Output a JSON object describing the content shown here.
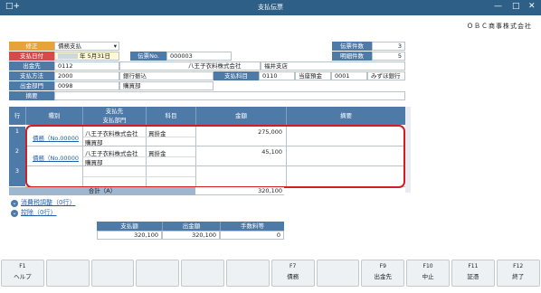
{
  "window": {
    "title": "支払伝票",
    "app_icon": "plus-icon"
  },
  "company": "ＯＢＣ商事株式会社",
  "header": {
    "correction_label": "修正",
    "correction_value": "債務支払",
    "date_label": "支払日付",
    "date_value": "年 5月31日",
    "voucher_label": "伝票No.",
    "voucher_value": "000003",
    "payee_label": "出金先",
    "payee_code": "0112",
    "payee_name": "八王子衣料株式会社",
    "payee_branch": "福井支店",
    "method_label": "支払方法",
    "method_code": "2000",
    "method_name": "銀行振込",
    "account_label": "支払科目",
    "account_code": "0110",
    "account_name": "当座預金",
    "bank_code": "0001",
    "bank_name": "みずほ銀行",
    "dept_label": "出金部門",
    "dept_code": "0098",
    "dept_name": "購買部",
    "memo_label": "摘要",
    "count_label": "伝票件数",
    "count_value": "3",
    "detail_label": "明細件数",
    "detail_value": "5"
  },
  "grid": {
    "columns": {
      "row": "行",
      "kind": "種別",
      "payee": "支払先",
      "payee_dept": "支払部門",
      "subject": "科目",
      "amount": "金額",
      "memo": "摘要"
    },
    "rows": [
      {
        "num": "1",
        "kind": "債務（No.00000",
        "payee": "八王子衣料株式会社",
        "dept": "購買部",
        "subject": "買掛金",
        "amount": "275,000"
      },
      {
        "num": "2",
        "kind": "債務（No.00000",
        "payee": "八王子衣料株式会社",
        "dept": "購買部",
        "subject": "買掛金",
        "amount": "45,100"
      },
      {
        "num": "3",
        "kind": "",
        "payee": "",
        "dept": "",
        "subject": "",
        "amount": ""
      }
    ],
    "total_label": "合計（A）",
    "total_value": "320,100"
  },
  "sections": {
    "tax": "消費税調整（0行）",
    "deduction": "控除（0行）"
  },
  "summary": {
    "headers": [
      "支払額",
      "出金額",
      "手数料等"
    ],
    "values": [
      "320,100",
      "320,100",
      "0"
    ]
  },
  "fkeys": [
    {
      "n": "F1",
      "l": "ヘルプ"
    },
    {
      "n": "",
      "l": ""
    },
    {
      "n": "",
      "l": ""
    },
    {
      "n": "",
      "l": ""
    },
    {
      "n": "",
      "l": ""
    },
    {
      "n": "",
      "l": ""
    },
    {
      "n": "F7",
      "l": "債務"
    },
    {
      "n": "",
      "l": ""
    },
    {
      "n": "F9",
      "l": "出金先"
    },
    {
      "n": "F10",
      "l": "中止"
    },
    {
      "n": "F11",
      "l": "証憑"
    },
    {
      "n": "F12",
      "l": "終了"
    }
  ]
}
